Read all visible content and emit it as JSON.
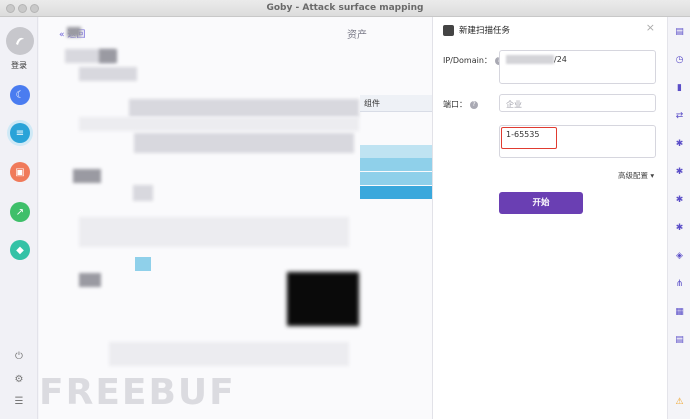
{
  "window": {
    "title": "Goby - Attack surface mapping"
  },
  "sidebar": {
    "login_label": "登录",
    "nav_icons": [
      {
        "name": "moon-icon",
        "color": "#4a7cf0",
        "glyph": "☾"
      },
      {
        "name": "list-icon",
        "color": "#2aa3d8",
        "glyph": "≡"
      },
      {
        "name": "report-icon",
        "color": "#f07a5a",
        "glyph": "▣"
      },
      {
        "name": "chart-icon",
        "color": "#3fbf6a",
        "glyph": "↗"
      },
      {
        "name": "plugin-icon",
        "color": "#34c2a6",
        "glyph": "◆"
      }
    ],
    "bottom_icons": [
      {
        "name": "power-icon",
        "glyph": "⏻"
      },
      {
        "name": "settings-icon",
        "glyph": "⚙"
      },
      {
        "name": "menu-icon",
        "glyph": "☰"
      }
    ]
  },
  "main": {
    "back_label": "« 返回",
    "title": "资产",
    "column_header": "组件",
    "watermark": "FREEBUF"
  },
  "scan_panel": {
    "title": "新建扫描任务",
    "close_glyph": "×",
    "ip_label": "IP/Domain：",
    "ip_value": "/24",
    "port_label": "端口：",
    "port_placeholder": "企业",
    "port_range": "1-65535",
    "advanced_label": "高级配置 ▾",
    "start_label": "开始",
    "accent_color": "#6a3fb3",
    "highlight_color": "#e03b30"
  },
  "right_rail": {
    "icons": [
      "task-icon",
      "clock-icon",
      "doc-icon",
      "swap-icon",
      "bug-icon",
      "bug-alt-icon",
      "bug-crawl-icon",
      "bug-spark-icon",
      "shield-icon",
      "share-icon",
      "grid-icon",
      "table-icon",
      "warning-icon"
    ],
    "warning_color": "#f0a020"
  }
}
